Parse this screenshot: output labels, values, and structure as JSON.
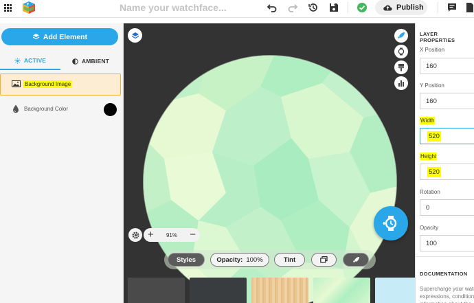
{
  "topbar": {
    "watchface_name_placeholder": "Name your watchface...",
    "publish_label": "Publish",
    "icons": [
      "apps-grid-icon",
      "logo-icon",
      "undo-icon",
      "redo-icon",
      "history-icon",
      "save-icon",
      "check-circle-icon",
      "cloud-upload-icon",
      "comment-icon",
      "document-icon"
    ]
  },
  "left_panel": {
    "add_element_label": "Add Element",
    "tabs": [
      {
        "label": "ACTIVE",
        "icon": "sun-icon",
        "selected": true
      },
      {
        "label": "AMBIENT",
        "icon": "half-moon-icon",
        "selected": false
      }
    ],
    "layers": [
      {
        "label": "Background Image",
        "icon": "image-icon",
        "selected": true
      },
      {
        "label": "Background Color",
        "icon": "droplet-icon",
        "color": "#000000"
      }
    ]
  },
  "canvas": {
    "zoom_level": "91%",
    "zoom_in": "+",
    "zoom_out": "−",
    "toolbar": {
      "styles_label": "Styles",
      "opacity_label": "Opacity:",
      "opacity_value": "100%",
      "tint_label": "Tint"
    },
    "right_tools": [
      "rocket-icon",
      "watch-icon",
      "paint-icon",
      "chart-icon"
    ],
    "bg_color": "#333333",
    "accent": "#29a7e8"
  },
  "properties": {
    "title": "LAYER PROPERTIES",
    "x_label": "X Position",
    "x_value": "160",
    "y_label": "Y Position",
    "y_value": "160",
    "width_label": "Width",
    "width_value": "520",
    "height_label": "Height",
    "height_value": "520",
    "rotation_label": "Rotation",
    "rotation_value": "0",
    "opacity_label": "Opacity",
    "opacity_value": "100",
    "documentation_title": "DOCUMENTATION",
    "documentation_text": "Supercharge your watc expressions, conditions information about tha"
  }
}
